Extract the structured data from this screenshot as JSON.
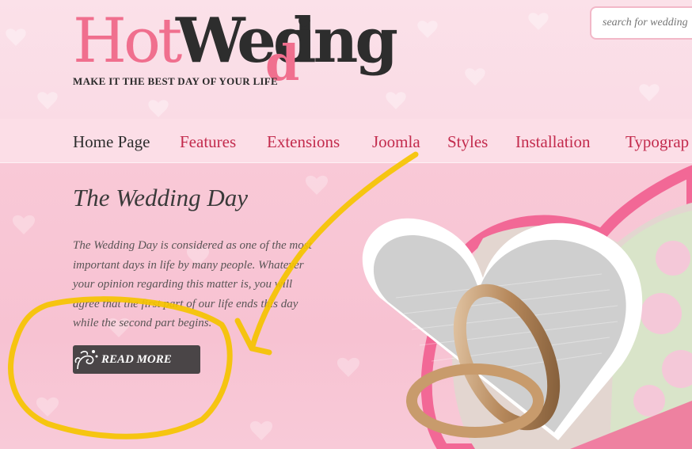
{
  "header": {
    "logo": {
      "part_hot": "Hot",
      "part_wed": "Wed",
      "part_d": "d",
      "part_ing": "ing"
    },
    "tagline": "MAKE IT THE BEST DAY OF YOUR LIFE",
    "search": {
      "placeholder": "search for wedding"
    }
  },
  "nav": {
    "items": [
      {
        "label": "Home Page",
        "active": true
      },
      {
        "label": "Features",
        "active": false
      },
      {
        "label": "Extensions",
        "active": false
      },
      {
        "label": "Joomla",
        "active": false
      },
      {
        "label": "Styles",
        "active": false
      },
      {
        "label": "Installation",
        "active": false
      },
      {
        "label": "Typograp",
        "active": false
      }
    ]
  },
  "hero": {
    "title": "The Wedding Day",
    "lines": [
      "The Wedding Day is considered as one of the most",
      "important days in life by many people. Whatever",
      "your opinion regarding this matter is, you will",
      "agree that the first part of our life ends this day",
      "while the second part begins."
    ],
    "button_label": "READ MORE"
  },
  "colors": {
    "accent_pink": "#f06f8e",
    "nav_link": "#c32b4d",
    "annotation_yellow": "#f5c400",
    "dark_text": "#2d2d2d"
  },
  "icons": [
    "swirl-ornament-icon",
    "heart-frame-icon",
    "wedding-rings-photo"
  ]
}
